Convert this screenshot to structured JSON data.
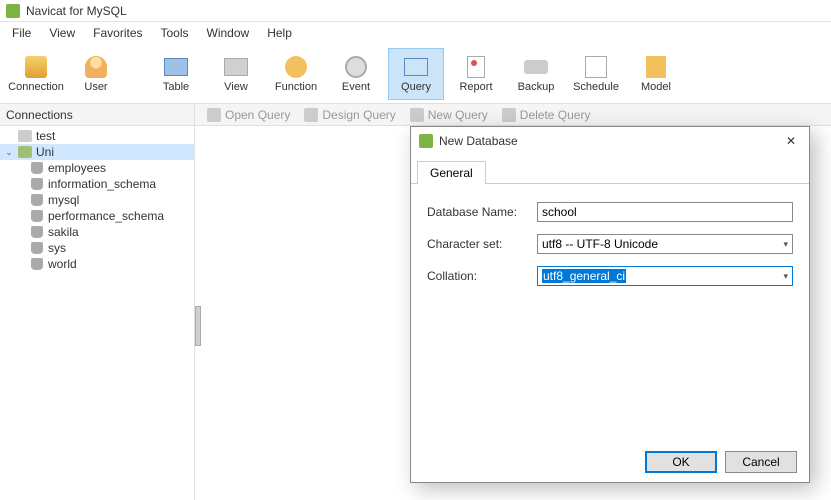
{
  "app": {
    "title": "Navicat for MySQL"
  },
  "menu": {
    "file": "File",
    "view": "View",
    "favorites": "Favorites",
    "tools": "Tools",
    "window": "Window",
    "help": "Help"
  },
  "toolbar": {
    "connection": "Connection",
    "user": "User",
    "table": "Table",
    "view": "View",
    "function": "Function",
    "event": "Event",
    "query": "Query",
    "report": "Report",
    "backup": "Backup",
    "schedule": "Schedule",
    "model": "Model"
  },
  "connections_header": "Connections",
  "query_ops": {
    "open": "Open Query",
    "design": "Design Query",
    "new": "New Query",
    "delete": "Delete Query"
  },
  "tree": {
    "test": "test",
    "uni": "Uni",
    "children": {
      "employees": "employees",
      "information_schema": "information_schema",
      "mysql": "mysql",
      "performance_schema": "performance_schema",
      "sakila": "sakila",
      "sys": "sys",
      "world": "world"
    }
  },
  "dialog": {
    "title": "New Database",
    "tab_general": "General",
    "labels": {
      "dbname": "Database Name:",
      "charset": "Character set:",
      "collation": "Collation:"
    },
    "values": {
      "dbname": "school",
      "charset": "utf8 -- UTF-8 Unicode",
      "collation": "utf8_general_ci"
    },
    "buttons": {
      "ok": "OK",
      "cancel": "Cancel"
    }
  }
}
